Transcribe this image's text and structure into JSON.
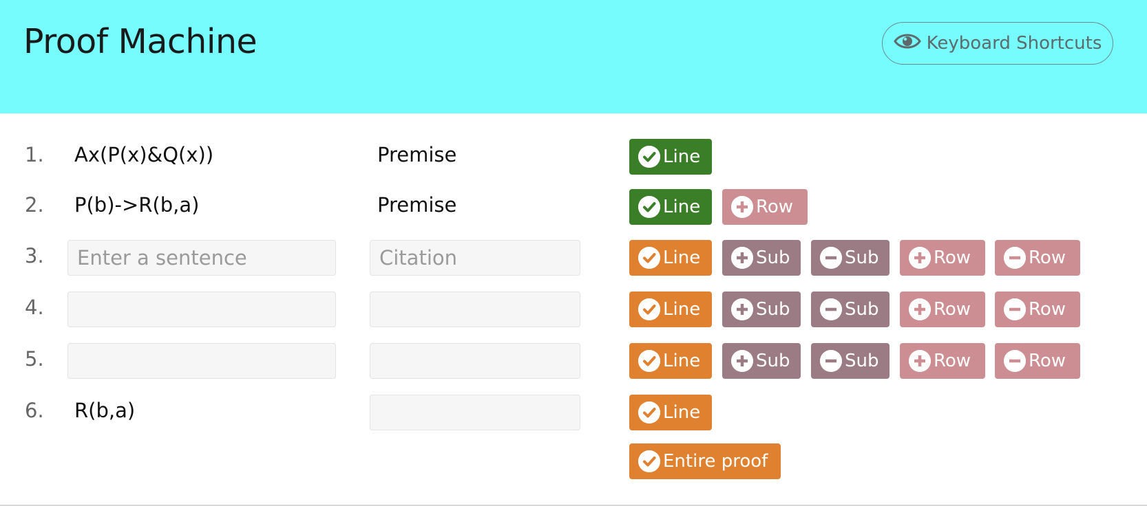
{
  "header": {
    "title": "Proof Machine",
    "shortcuts_label": "Keyboard Shortcuts",
    "shortcuts_icon": "eye-icon",
    "background": "#77fcfd"
  },
  "buttons": {
    "line": "Line",
    "sub": "Sub",
    "row": "Row",
    "entire_proof": "Entire proof"
  },
  "colors": {
    "checked": "#3a7f28",
    "unchecked": "#e0812f",
    "sub": "#9b7c84",
    "row": "#cc8e92"
  },
  "rows": [
    {
      "number": "1.",
      "sentence": "Ax(P(x)&Q(x))",
      "citation": "Premise",
      "line_status": "checked"
    },
    {
      "number": "2.",
      "sentence": "P(b)->R(b,a)",
      "citation": "Premise",
      "line_status": "checked"
    },
    {
      "number": "3.",
      "sentence": "",
      "sentence_placeholder": "Enter a sentence",
      "citation": "",
      "citation_placeholder": "Citation",
      "line_status": "unchecked"
    },
    {
      "number": "4.",
      "sentence": "",
      "sentence_placeholder": "",
      "citation": "",
      "citation_placeholder": "",
      "line_status": "unchecked"
    },
    {
      "number": "5.",
      "sentence": "",
      "sentence_placeholder": "",
      "citation": "",
      "citation_placeholder": "",
      "line_status": "unchecked"
    },
    {
      "number": "6.",
      "sentence": "R(b,a)",
      "citation": "",
      "citation_placeholder": "",
      "line_status": "unchecked"
    }
  ]
}
